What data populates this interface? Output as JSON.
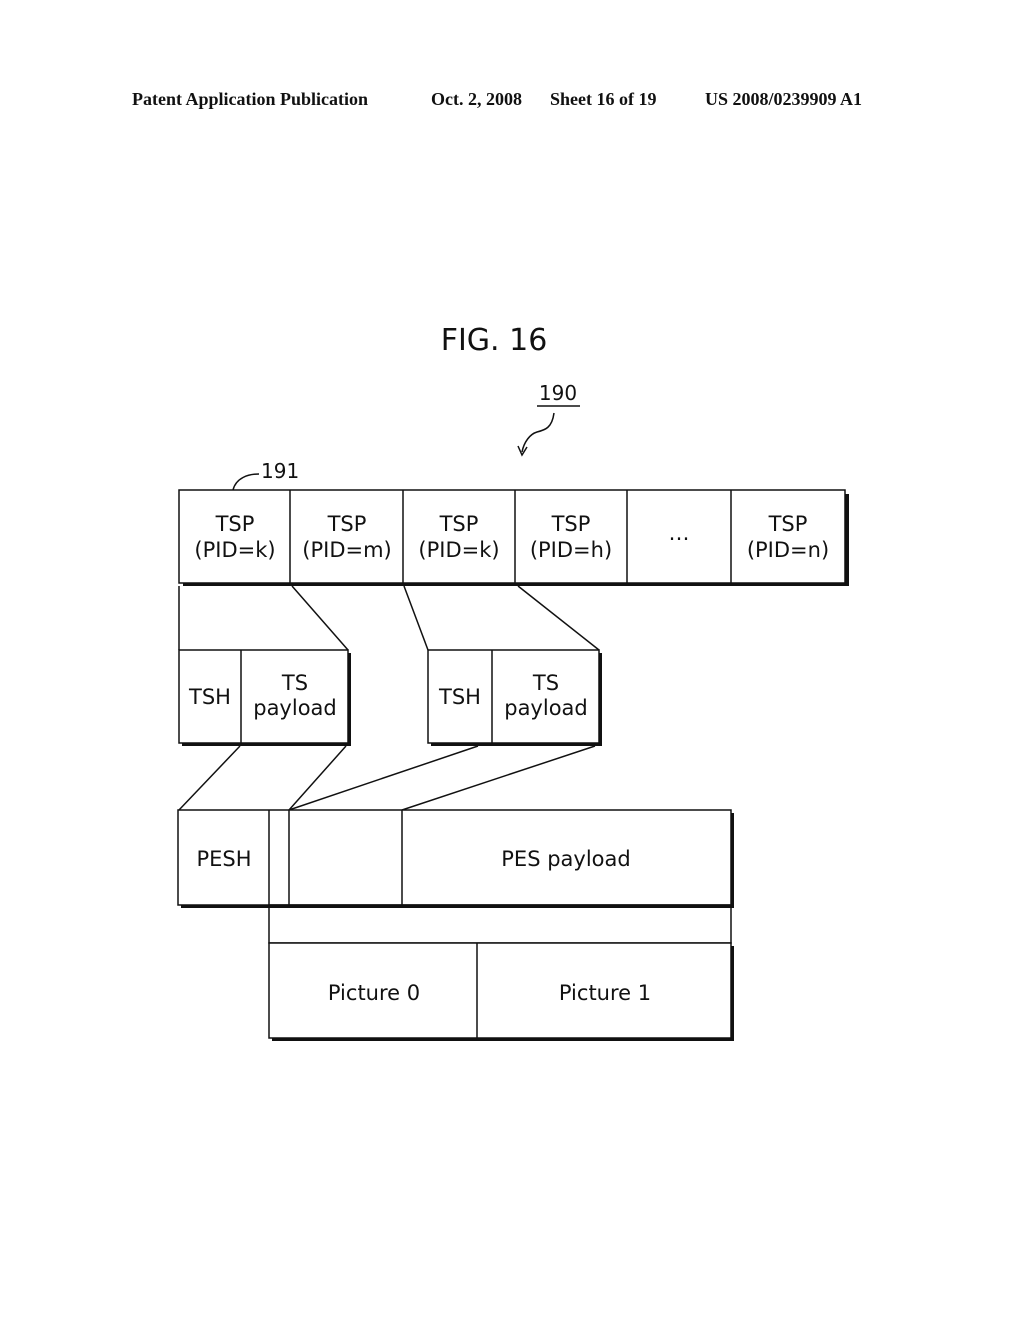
{
  "header": {
    "publication": "Patent Application Publication",
    "date": "Oct. 2, 2008",
    "sheet": "Sheet 16 of 19",
    "number": "US 2008/0239909 A1"
  },
  "figure": {
    "title": "FIG. 16",
    "ref_stream": "190",
    "ref_packet": "191"
  },
  "tsp_row": [
    {
      "line1": "TSP",
      "line2": "(PID=k)"
    },
    {
      "line1": "TSP",
      "line2": "(PID=m)"
    },
    {
      "line1": "TSP",
      "line2": "(PID=k)"
    },
    {
      "line1": "TSP",
      "line2": "(PID=h)"
    },
    {
      "line1": "…",
      "line2": ""
    },
    {
      "line1": "TSP",
      "line2": "(PID=n)"
    }
  ],
  "ts_packets": [
    {
      "header": "TSH",
      "payload_line1": "TS",
      "payload_line2": "payload"
    },
    {
      "header": "TSH",
      "payload_line1": "TS",
      "payload_line2": "payload"
    }
  ],
  "pes": {
    "header": "PESH",
    "payload": "PES payload"
  },
  "pictures": [
    "Picture 0",
    "Picture 1"
  ]
}
